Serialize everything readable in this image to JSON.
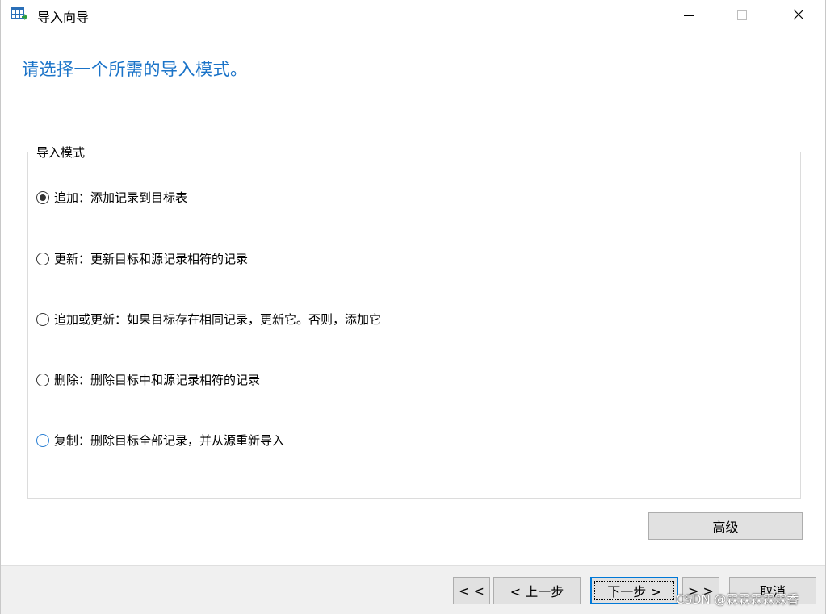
{
  "window": {
    "title": "导入向导",
    "app_icon": "table-import-icon",
    "controls": {
      "minimize": "minimize-icon",
      "maximize": "maximize-icon",
      "close": "close-icon"
    }
  },
  "page": {
    "heading": "请选择一个所需的导入模式。"
  },
  "import_mode": {
    "legend": "导入模式",
    "options": [
      {
        "label": "追加：添加记录到目标表",
        "checked": true
      },
      {
        "label": "更新：更新目标和源记录相符的记录",
        "checked": false
      },
      {
        "label": "追加或更新：如果目标存在相同记录，更新它。否则，添加它",
        "checked": false
      },
      {
        "label": "删除：删除目标中和源记录相符的记录",
        "checked": false
      },
      {
        "label": "复制：删除目标全部记录，并从源重新导入",
        "checked": false
      }
    ]
  },
  "buttons": {
    "advanced": "高级",
    "first": "< <",
    "prev": "< 上一步",
    "next": "下一步 >",
    "last": "> >",
    "cancel": "取消"
  },
  "watermark": "CSDN @霖霖霖霖霖香",
  "colors": {
    "heading": "#1a73c8",
    "default_button_border": "#0078d7"
  }
}
